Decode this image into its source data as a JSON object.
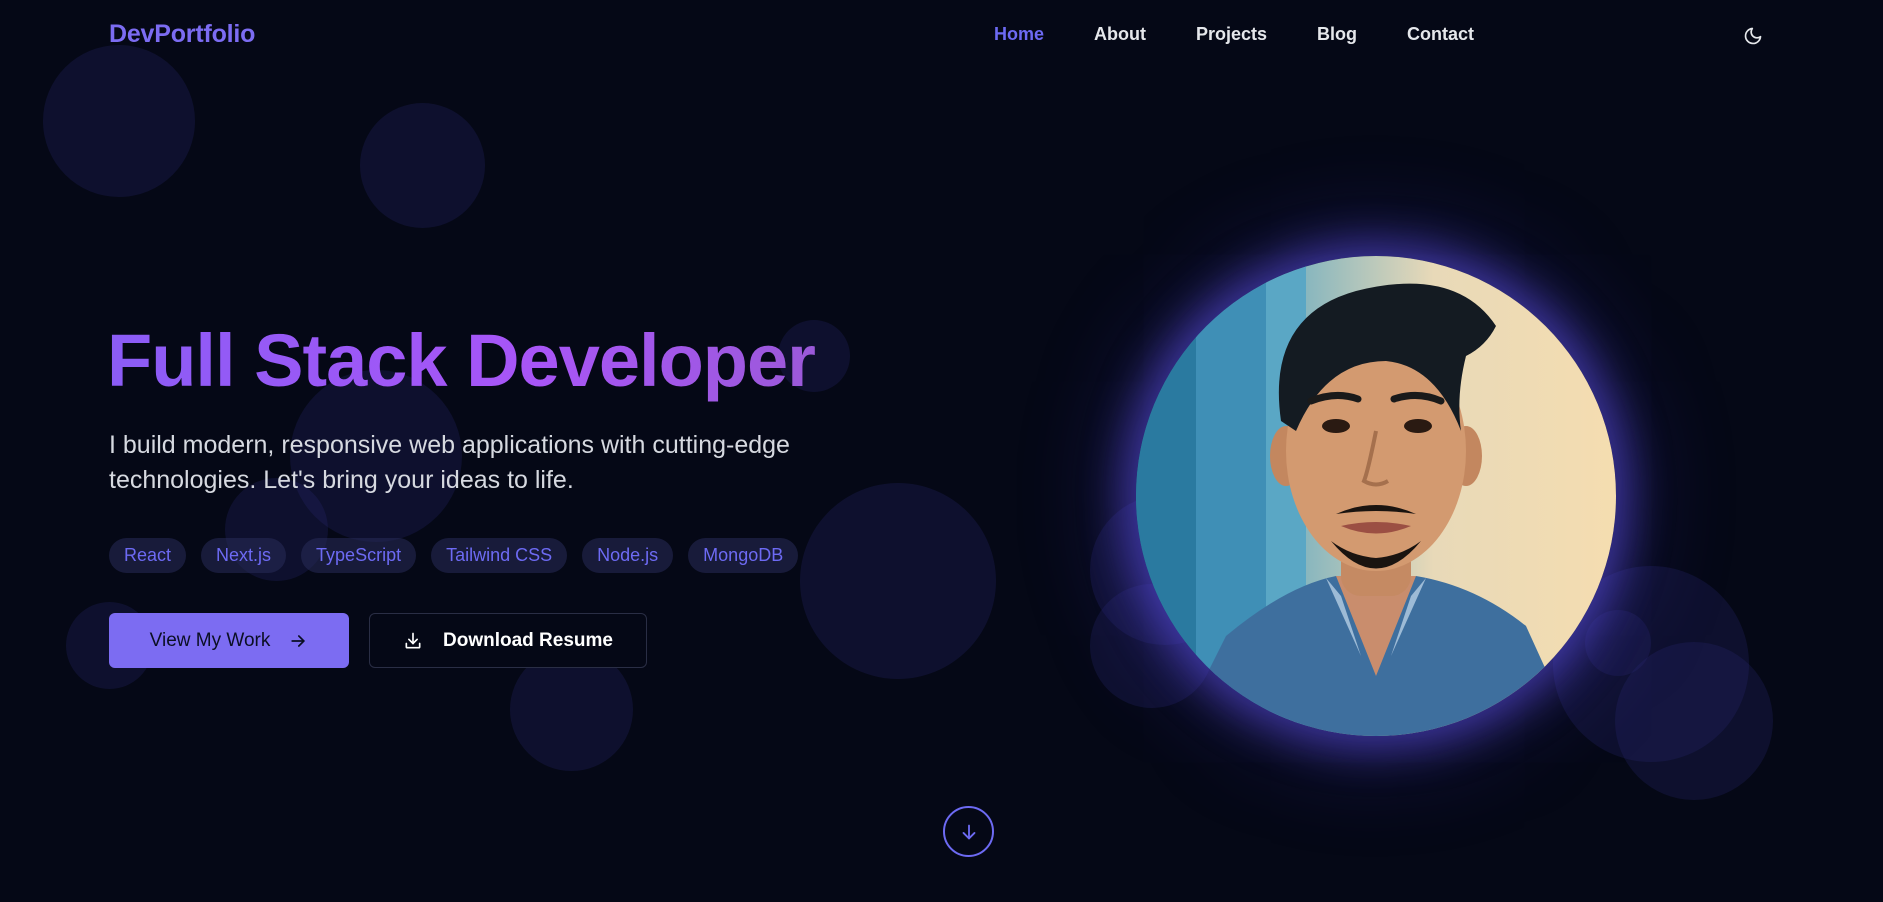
{
  "brand": {
    "logo": "DevPortfolio"
  },
  "nav": {
    "items": [
      {
        "label": "Home",
        "active": true
      },
      {
        "label": "About",
        "active": false
      },
      {
        "label": "Projects",
        "active": false
      },
      {
        "label": "Blog",
        "active": false
      },
      {
        "label": "Contact",
        "active": false
      }
    ],
    "theme_toggle_icon": "moon-icon"
  },
  "hero": {
    "title": "Full Stack Developer",
    "subtitle": "I build modern, responsive web applications with cutting-edge technologies. Let's bring your ideas to life.",
    "tags": [
      "React",
      "Next.js",
      "TypeScript",
      "Tailwind CSS",
      "Node.js",
      "MongoDB"
    ],
    "primary_button": {
      "label": "View My Work",
      "icon": "arrow-right-icon"
    },
    "secondary_button": {
      "label": "Download Resume",
      "icon": "download-icon"
    },
    "scroll_icon": "arrow-down-icon"
  },
  "colors": {
    "background": "#050816",
    "accent": "#7c6cf2",
    "title_gradient_start": "#8b5cf6",
    "title_gradient_end": "#a855f7"
  }
}
